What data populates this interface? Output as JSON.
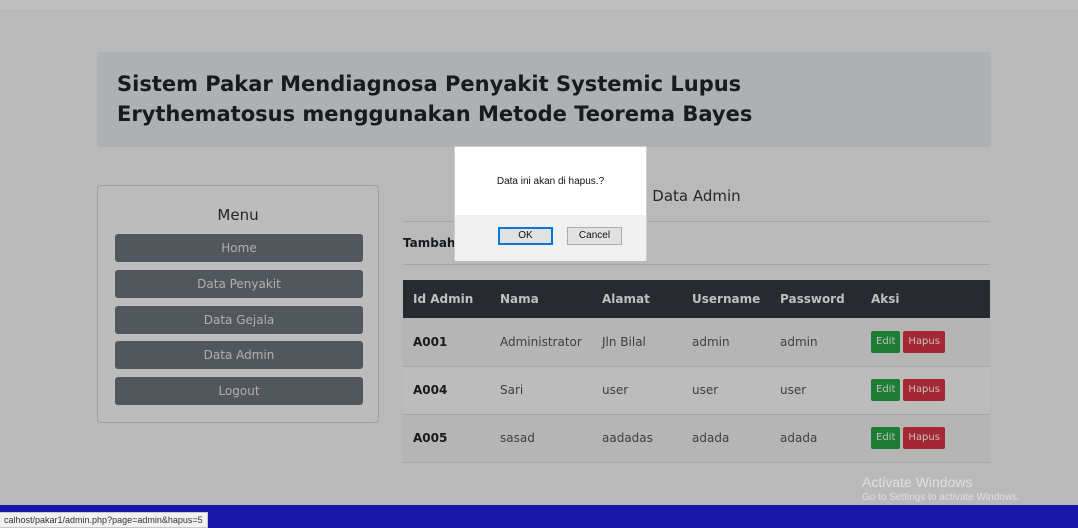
{
  "header": {
    "title": "Sistem Pakar Mendiagnosa Penyakit Systemic Lupus Erythematosus menggunakan Metode Teorema Bayes"
  },
  "menu": {
    "title": "Menu",
    "items": [
      {
        "label": "Home"
      },
      {
        "label": "Data Penyakit"
      },
      {
        "label": "Data Gejala"
      },
      {
        "label": "Data Admin"
      },
      {
        "label": "Logout"
      }
    ]
  },
  "content": {
    "title": "Data Admin",
    "add_label": "Tambah",
    "table": {
      "columns": [
        "Id Admin",
        "Nama",
        "Alamat",
        "Username",
        "Password",
        "Aksi"
      ],
      "rows": [
        {
          "id": "A001",
          "nama": "Administrator",
          "alamat": "Jln Bilal",
          "username": "admin",
          "password": "admin"
        },
        {
          "id": "A004",
          "nama": "Sari",
          "alamat": "user",
          "username": "user",
          "password": "user"
        },
        {
          "id": "A005",
          "nama": "sasad",
          "alamat": "aadadas",
          "username": "adada",
          "password": "adada"
        }
      ],
      "edit_label": "Edit",
      "delete_label": "Hapus"
    }
  },
  "dialog": {
    "message": "Data ini akan di hapus.?",
    "ok_label": "OK",
    "cancel_label": "Cancel"
  },
  "watermark": {
    "line1": "Activate Windows",
    "line2": "Go to Settings to activate Windows."
  },
  "status_bar": {
    "url": "calhost/pakar1/admin.php?page=admin&hapus=5"
  },
  "colors": {
    "table_header": "#343a40",
    "menu_button": "#6c757d",
    "edit_button": "#28a745",
    "delete_button": "#dc3545",
    "taskbar": "#1616a8"
  }
}
